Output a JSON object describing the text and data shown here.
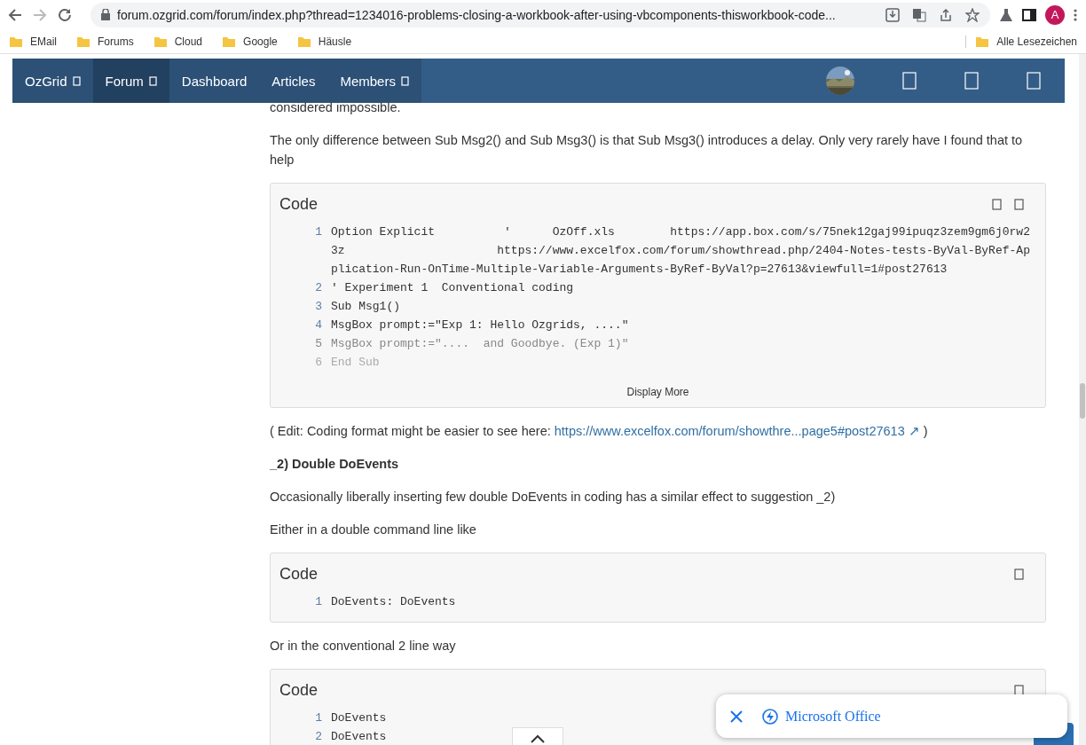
{
  "browser": {
    "url": "forum.ozgrid.com/forum/index.php?thread=1234016-problems-closing-a-workbook-after-using-vbcomponents-thisworkbook-code...",
    "profile": "A",
    "bookmarks": [
      "EMail",
      "Forums",
      "Cloud",
      "Google",
      "Häusle"
    ],
    "all_bookmarks": "Alle Lesezeichen"
  },
  "nav": {
    "items": [
      {
        "label": "OzGrid",
        "has_menu": true,
        "selected": false
      },
      {
        "label": "Forum",
        "has_menu": true,
        "selected": true
      },
      {
        "label": "Dashboard",
        "has_menu": false,
        "selected": false
      },
      {
        "label": "Articles",
        "has_menu": false,
        "selected": false
      },
      {
        "label": "Members",
        "has_menu": true,
        "selected": false
      }
    ]
  },
  "post": [
    {
      "kind": "cut",
      "text": "considered impossible."
    },
    {
      "kind": "text",
      "text": "The only difference between Sub Msg2() and Sub Msg3() is that Sub Msg3() introduces a delay. Only very rarely have I found that to help"
    },
    {
      "kind": "code",
      "title": "Code",
      "expandable": true,
      "more_label": "Display More",
      "lines": [
        {
          "n": "1",
          "text": "Option Explicit          '      OzOff.xls        https://app.box.com/s/75nek12gaj99ipuqz3zem9gm6j0rw23z                      https://www.excelfox.com/forum/showthread.php/2404-Notes-tests-ByVal-ByRef-Application-Run-OnTime-Multiple-Variable-Arguments-ByRef-ByVal?p=27613&viewfull=1#post27613"
        },
        {
          "n": "2",
          "text": "' Experiment 1  Conventional coding"
        },
        {
          "n": "3",
          "text": "Sub Msg1()"
        },
        {
          "n": "4",
          "text": "MsgBox prompt:=\"Exp 1: Hello Ozgrids, ....\""
        },
        {
          "n": "5",
          "text": "MsgBox prompt:=\"....  and Goodbye. (Exp 1)\""
        },
        {
          "n": "6",
          "text": "End Sub"
        }
      ]
    },
    {
      "kind": "link",
      "before": "( Edit: Coding format might be easier to see here: ",
      "link": "https://www.excelfox.com/forum/showthre...page5#post27613 ↗",
      "after": " )"
    },
    {
      "kind": "heading",
      "text": "_2) Double DoEvents"
    },
    {
      "kind": "text",
      "text": "Occasionally liberally inserting few double DoEvents in coding has a similar effect to suggestion _2)"
    },
    {
      "kind": "text",
      "text": "Either in a double command line like"
    },
    {
      "kind": "code",
      "title": "Code",
      "expandable": false,
      "lines": [
        {
          "n": "1",
          "text": "DoEvents: DoEvents"
        }
      ]
    },
    {
      "kind": "text",
      "text": "Or in the conventional 2 line way"
    },
    {
      "kind": "code",
      "title": "Code",
      "expandable": false,
      "lines": [
        {
          "n": "1",
          "text": "DoEvents"
        },
        {
          "n": "2",
          "text": "DoEvents"
        }
      ]
    }
  ],
  "popup": {
    "label": "Microsoft Office"
  }
}
